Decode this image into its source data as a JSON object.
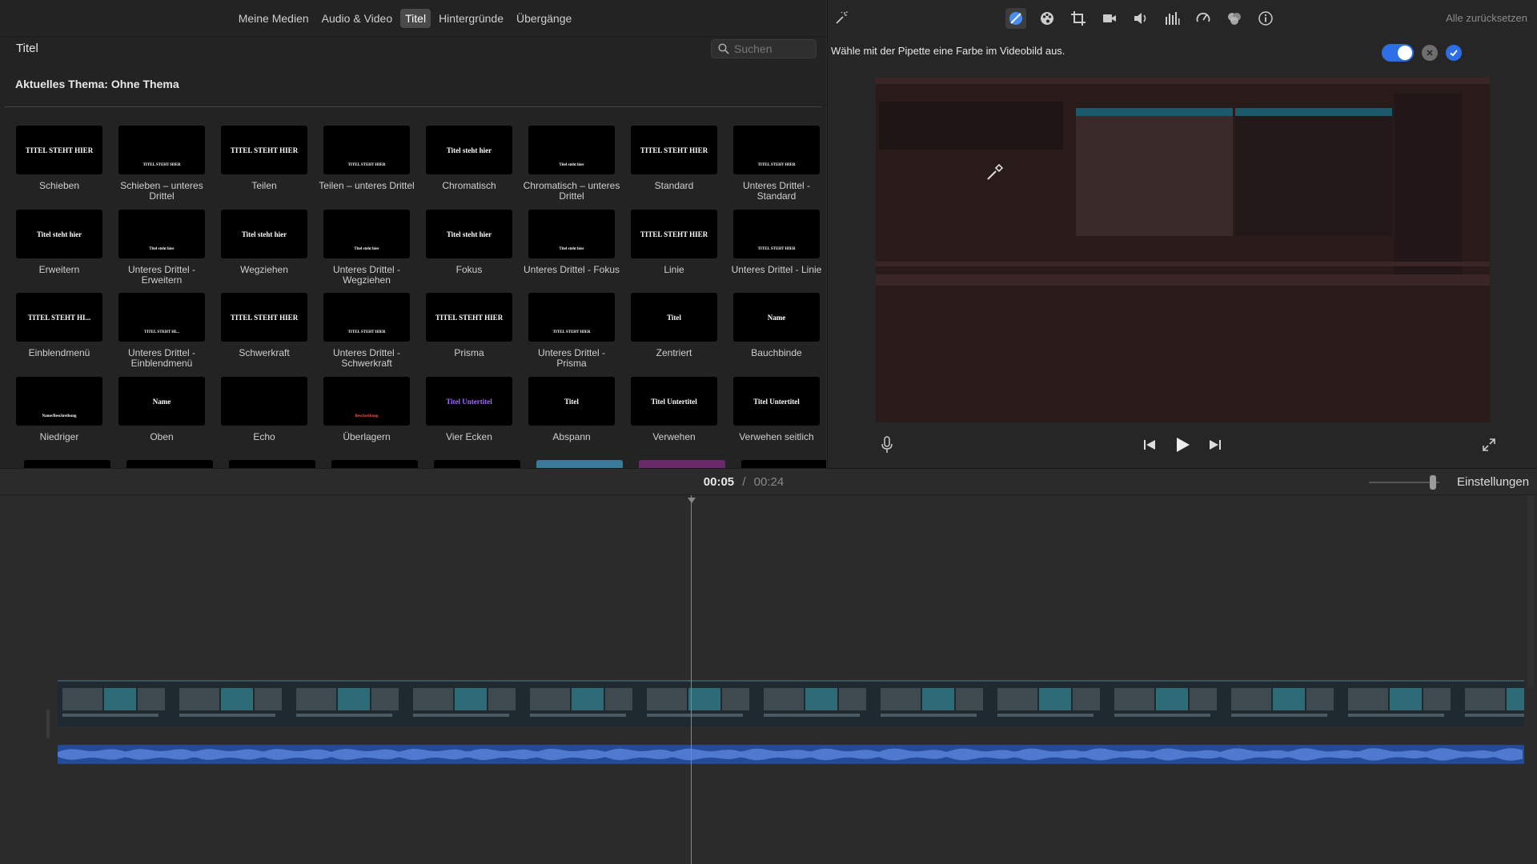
{
  "browser": {
    "tabs": [
      {
        "label": "Meine Medien",
        "active": false
      },
      {
        "label": "Audio & Video",
        "active": false
      },
      {
        "label": "Titel",
        "active": true
      },
      {
        "label": "Hintergründe",
        "active": false
      },
      {
        "label": "Übergänge",
        "active": false
      }
    ],
    "section_title": "Titel",
    "search_placeholder": "Suchen",
    "theme_label": "Aktuelles Thema: Ohne Thema",
    "titles": [
      {
        "label": "Schieben",
        "thumb": "TITEL STEHT HIER"
      },
      {
        "label": "Schieben – unteres Drittel",
        "thumb": "TITEL STEHT HIER"
      },
      {
        "label": "Teilen",
        "thumb": "TITEL STEHT HIER"
      },
      {
        "label": "Teilen – unteres Drittel",
        "thumb": "TITEL STEHT HIER"
      },
      {
        "label": "Chromatisch",
        "thumb": "Titel steht hier"
      },
      {
        "label": "Chromatisch – unteres Drittel",
        "thumb": "Titel steht hier"
      },
      {
        "label": "Standard",
        "thumb": "TITEL STEHT HIER"
      },
      {
        "label": "Unteres Drittel - Standard",
        "thumb": "TITEL STEHT HIER"
      },
      {
        "label": "Erweitern",
        "thumb": "Titel steht hier"
      },
      {
        "label": "Unteres Drittel - Erweitern",
        "thumb": "Titel steht hier"
      },
      {
        "label": "Wegziehen",
        "thumb": "Titel steht hier"
      },
      {
        "label": "Unteres Drittel - Wegziehen",
        "thumb": "Titel steht hier"
      },
      {
        "label": "Fokus",
        "thumb": "Titel steht hier"
      },
      {
        "label": "Unteres Drittel - Fokus",
        "thumb": "Titel steht hier"
      },
      {
        "label": "Linie",
        "thumb": "TITEL STEHT HIER"
      },
      {
        "label": "Unteres Drittel - Linie",
        "thumb": "TITEL STEHT HIER"
      },
      {
        "label": "Einblendmenü",
        "thumb": "TITEL STEHT HI..."
      },
      {
        "label": "Unteres Drittel - Einblendmenü",
        "thumb": "TITEL STEHT HI..."
      },
      {
        "label": "Schwerkraft",
        "thumb": "TITEL STEHT HIER"
      },
      {
        "label": "Unteres Drittel - Schwerkraft",
        "thumb": "TITEL STEHT HIER"
      },
      {
        "label": "Prisma",
        "thumb": "TITEL STEHT HIER"
      },
      {
        "label": "Unteres Drittel - Prisma",
        "thumb": "TITEL STEHT HIER"
      },
      {
        "label": "Zentriert",
        "thumb": "Titel"
      },
      {
        "label": "Bauchbinde",
        "thumb": "Name"
      },
      {
        "label": "Niedriger",
        "thumb": "Name/Beschreibung"
      },
      {
        "label": "Oben",
        "thumb": "Name"
      },
      {
        "label": "Echo",
        "thumb": ""
      },
      {
        "label": "Überlagern",
        "thumb": "Beschreibung"
      },
      {
        "label": "Vier Ecken",
        "thumb": "Titel Untertitel"
      },
      {
        "label": "Abspann",
        "thumb": "Titel"
      },
      {
        "label": "Verwehen",
        "thumb": "Titel Untertitel"
      },
      {
        "label": "Verwehen seitlich",
        "thumb": "Titel Untertitel"
      }
    ]
  },
  "viewer": {
    "reset_all_label": "Alle zurücksetzen",
    "eyedropper_hint": "Wähle mit der Pipette eine Farbe im Videobild aus.",
    "tools": [
      "magic-wand-icon",
      "color-balance-icon",
      "color-palette-icon",
      "crop-icon",
      "camera-icon",
      "volume-icon",
      "equalizer-icon",
      "speed-icon",
      "filter-icon",
      "info-icon"
    ]
  },
  "timeline": {
    "current_time": "00:05",
    "separator": "/",
    "total_time": "00:24",
    "settings_label": "Einstellungen"
  },
  "colors": {
    "accent": "#2d6ee6",
    "audio_track": "#264a9a",
    "panel_bg": "#232323"
  }
}
